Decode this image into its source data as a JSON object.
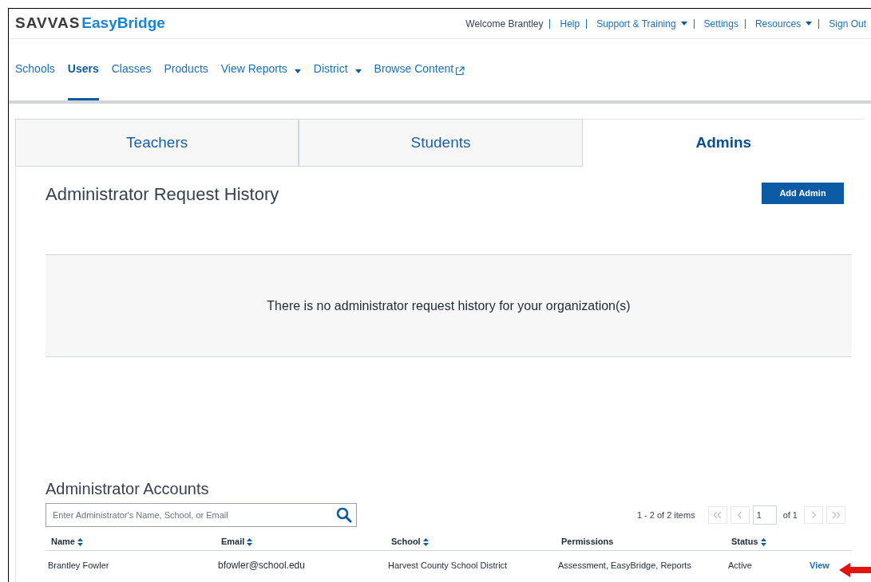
{
  "logo": {
    "brand": "SAVVAS",
    "product": "EasyBridge"
  },
  "top_links": [
    {
      "label": "Welcome Brantley",
      "kind": "text"
    },
    {
      "label": "Help",
      "kind": "link"
    },
    {
      "label": "Support & Training",
      "kind": "menu"
    },
    {
      "label": "Settings",
      "kind": "link"
    },
    {
      "label": "Resources",
      "kind": "menu"
    },
    {
      "label": "Sign Out",
      "kind": "link"
    }
  ],
  "nav": [
    {
      "label": "Schools",
      "kind": "link",
      "selected": false
    },
    {
      "label": "Users",
      "kind": "link",
      "selected": true
    },
    {
      "label": "Classes",
      "kind": "link",
      "selected": false
    },
    {
      "label": "Products",
      "kind": "link",
      "selected": false
    },
    {
      "label": "View Reports",
      "kind": "menu",
      "selected": false
    },
    {
      "label": "District",
      "kind": "menu",
      "selected": false
    },
    {
      "label": "Browse Content",
      "kind": "external",
      "selected": false
    }
  ],
  "tabs": [
    {
      "label": "Teachers",
      "selected": false
    },
    {
      "label": "Students",
      "selected": false
    },
    {
      "label": "Admins",
      "selected": true
    }
  ],
  "request_history": {
    "title": "Administrator Request History",
    "add_button": "Add Admin",
    "empty_message": "There is no administrator request history for your organization(s)"
  },
  "accounts": {
    "title": "Administrator Accounts",
    "search": {
      "placeholder": "Enter Administrator's Name, School, or Email"
    },
    "pagination": {
      "summary": "1 - 2 of 2 items",
      "page": "1",
      "of": "of 1"
    },
    "columns": [
      {
        "label": "Name",
        "sortable": true
      },
      {
        "label": "Email",
        "sortable": true
      },
      {
        "label": "School",
        "sortable": true
      },
      {
        "label": "Permissions",
        "sortable": false
      },
      {
        "label": "Status",
        "sortable": true
      }
    ],
    "rows": [
      {
        "cells": [
          "Brantley Fowler",
          "bfowler@school.edu",
          "Harvest County School District",
          "Assessment, EasyBridge, Reports",
          "Active"
        ],
        "action": "View"
      }
    ]
  }
}
